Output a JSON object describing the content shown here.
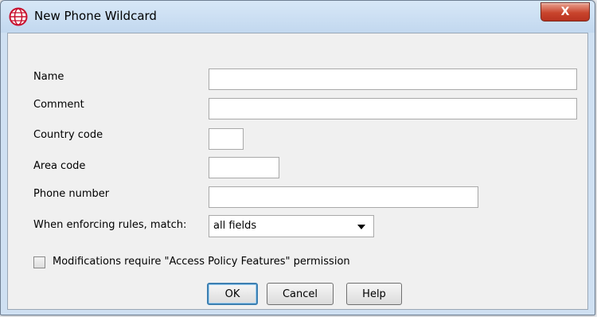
{
  "window": {
    "title": "New Phone Wildcard",
    "close_glyph": "X"
  },
  "form": {
    "name_label": "Name",
    "comment_label": "Comment",
    "country_code_label": "Country code",
    "area_code_label": "Area code",
    "phone_number_label": "Phone number",
    "match_label": "When enforcing rules, match:",
    "match_value": "all fields",
    "name_value": "",
    "comment_value": "",
    "country_code_value": "",
    "area_code_value": "",
    "phone_number_value": "",
    "permission_label": "Modifications require \"Access Policy Features\" permission",
    "permission_checked": false
  },
  "buttons": {
    "ok": "OK",
    "cancel": "Cancel",
    "help": "Help"
  },
  "icons": {
    "app": "globe-icon",
    "close": "close-icon",
    "dropdown": "chevron-down-icon"
  },
  "colors": {
    "titlebar": "#c2d8ef",
    "close": "#c9452d",
    "default_button_border": "#3c7fb1"
  }
}
